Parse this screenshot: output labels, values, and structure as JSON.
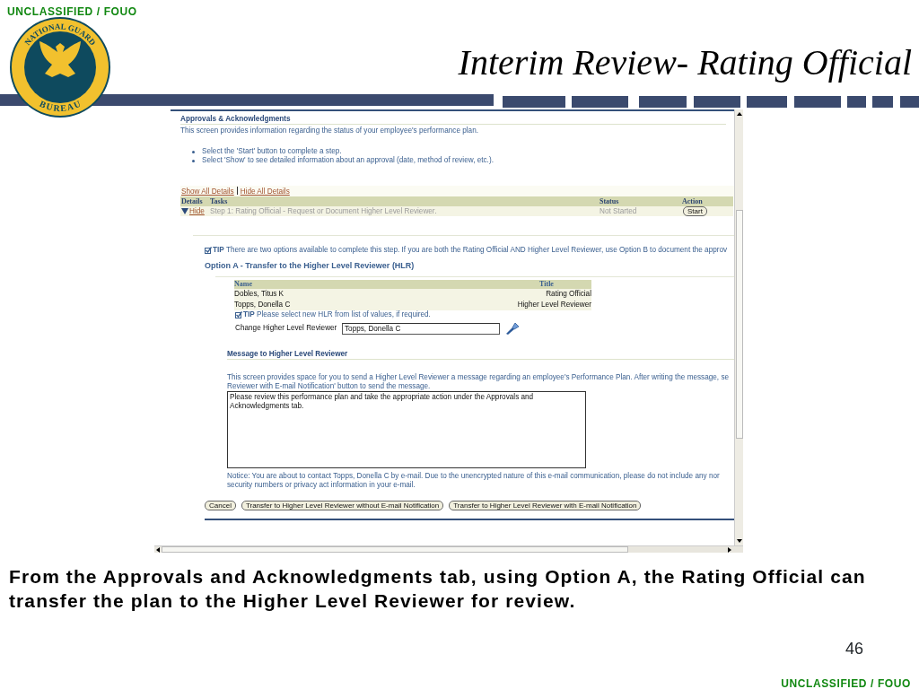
{
  "classification_top": "UNCLASSIFIED / FOUO",
  "logo": {
    "top_text": "NATIONAL GUARD",
    "bottom_text": "BUREAU"
  },
  "title": "Interim Review- Rating Official",
  "screen": {
    "section_title": "Approvals & Acknowledgments",
    "description": "This screen provides information regarding the status of your employee's performance plan.",
    "bullets": [
      "Select the 'Start' button to complete a step.",
      "Select 'Show' to see detailed information about an approval (date, method of review, etc.)."
    ],
    "detail_links": [
      "Show All Details",
      "Hide All Details"
    ],
    "tasks_table": {
      "columns": [
        "Details",
        "Tasks",
        "Status",
        "Action"
      ],
      "rows": [
        {
          "toggle": "Hide",
          "expanded": true,
          "task": "Step 1: Rating Official - Request or Document Higher Level Reviewer.",
          "status": "Not Started",
          "action": "Start"
        }
      ]
    },
    "tip": "**TIP** There are two options available to complete this step. If you are both the Rating Official AND Higher Level Reviewer, use Option B to document the approv",
    "option_title": "Option A - Transfer to the Higher Level Reviewer (HLR)",
    "reviewers_table": {
      "columns": [
        "Name",
        "Title"
      ],
      "rows": [
        [
          "Dobles, Titus K",
          "Rating Official"
        ],
        [
          "Topps, Donella C",
          "Higher Level Reviewer"
        ]
      ]
    },
    "reviewer_tip": "**TIP** Please select new HLR from list of values, if required.",
    "change_reviewer": {
      "label": "Change Higher Level Reviewer",
      "value": "Topps, Donella C"
    },
    "message_title": "Message to Higher Level Reviewer",
    "message_description": [
      "This screen provides space for you to send a Higher Level Reviewer a message regarding an employee's Performance Plan. After writing the message, se",
      "Reviewer with E-mail Notification' button to send the message."
    ],
    "message_value": "Please review this performance plan and take the appropriate action under the Approvals and Acknowledgments tab.",
    "notice": [
      "Notice: You are about to contact Topps, Donella C by e-mail. Due to the unencrypted nature of this e-mail communication, please do not include any nor",
      "security numbers or privacy act information in your e-mail."
    ],
    "buttons": [
      "Cancel",
      "Transfer to Higher Level Reviewer without E-mail Notification",
      "Transfer to Higher Level Reviewer with E-mail Notification"
    ]
  },
  "caption": "From the Approvals and Acknowledgments tab, using Option A, the Rating Official can transfer the plan to the Higher Level Reviewer for review.",
  "page_number": "46",
  "classification_bottom": "UNCLASSIFIED / FOUO"
}
